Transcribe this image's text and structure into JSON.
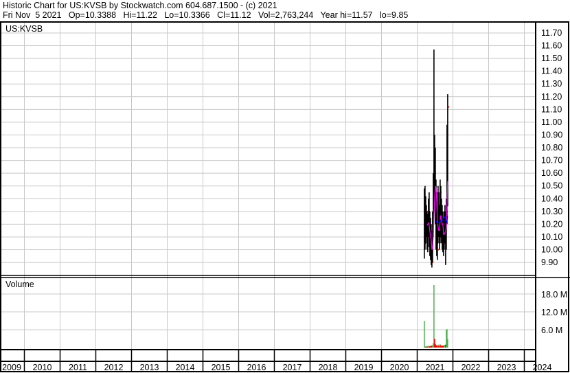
{
  "header": {
    "title": "Historic Chart for US:KVSB by Stockwatch.com 604.687.1500 - (c) 2021",
    "quote_line": "Fri Nov  5 2021   Op=10.3388   Hi=11.22   Lo=10.3366   Cl=11.12   Vol=2,763,244   Year hi=11.57   lo=9.85"
  },
  "colors": {
    "bar": "#000000",
    "ma_short": "#ff00ff",
    "ma_long": "#0000ff",
    "vol_up": "#4caf50",
    "vol_down": "#ff0000",
    "grid": "#c8c8c8"
  },
  "chart_data": [
    {
      "type": "line",
      "title": "US:KVSB",
      "subtype": "ohlc",
      "ylim": [
        9.9,
        11.7
      ],
      "y_ticks": [
        "11.70",
        "11.60",
        "11.50",
        "11.40",
        "11.30",
        "11.20",
        "11.10",
        "11.00",
        "10.90",
        "10.80",
        "10.70",
        "10.60",
        "10.50",
        "10.40",
        "10.30",
        "10.20",
        "10.10",
        "10.00",
        "9.90"
      ],
      "x_ticks": [
        "2009",
        "2010",
        "2011",
        "2012",
        "2013",
        "2014",
        "2015",
        "2016",
        "2017",
        "2018",
        "2019",
        "2020",
        "2021",
        "2022",
        "2023",
        "2024"
      ],
      "grid": true,
      "start_year_fraction": 2021.2,
      "bars": {
        "high": [
          10.48,
          10.5,
          10.42,
          10.35,
          10.3,
          10.28,
          10.4,
          10.45,
          10.3,
          10.25,
          10.2,
          10.15,
          10.3,
          10.6,
          11.57,
          10.9,
          10.8,
          10.55,
          10.45,
          10.3,
          10.5,
          10.45,
          10.35,
          10.55,
          10.5,
          10.4,
          10.35,
          10.3,
          10.25,
          10.3,
          10.35,
          10.3,
          10.4,
          10.98,
          11.22
        ],
        "low": [
          9.93,
          10.0,
          10.05,
          10.1,
          10.0,
          9.98,
          10.1,
          10.02,
          9.95,
          9.92,
          9.88,
          9.86,
          9.9,
          10.1,
          10.3,
          10.4,
          10.2,
          10.0,
          9.95,
          9.92,
          10.05,
          10.1,
          10.0,
          10.05,
          10.1,
          10.05,
          10.0,
          9.98,
          9.95,
          10.0,
          10.05,
          9.88,
          10.0,
          10.2,
          10.34
        ],
        "close": [
          10.05,
          10.25,
          10.2,
          10.3,
          10.15,
          10.1,
          10.3,
          10.12,
          10.05,
          9.98,
          9.95,
          9.9,
          10.2,
          10.5,
          10.8,
          10.6,
          10.4,
          10.1,
          10.05,
          10.0,
          10.35,
          10.25,
          10.1,
          10.45,
          10.2,
          10.15,
          10.12,
          10.08,
          10.05,
          10.2,
          10.22,
          10.15,
          10.3,
          10.9,
          11.12
        ]
      }
    },
    {
      "type": "bar",
      "title": "Volume",
      "ylabel": "Volume (M)",
      "ylim": [
        0,
        24
      ],
      "y_ticks": [
        "18.0 M",
        "12.0 M",
        "6.0 M"
      ],
      "values": [
        9.0,
        0.4,
        0.3,
        0.5,
        0.3,
        0.4,
        0.6,
        0.3,
        0.5,
        0.4,
        0.7,
        0.5,
        0.8,
        1.5,
        21.0,
        3.0,
        1.2,
        0.9,
        0.6,
        0.5,
        1.0,
        0.7,
        0.6,
        1.1,
        0.8,
        0.6,
        0.5,
        0.7,
        0.6,
        0.8,
        0.9,
        1.0,
        6.0,
        6.2,
        2.8
      ]
    }
  ]
}
